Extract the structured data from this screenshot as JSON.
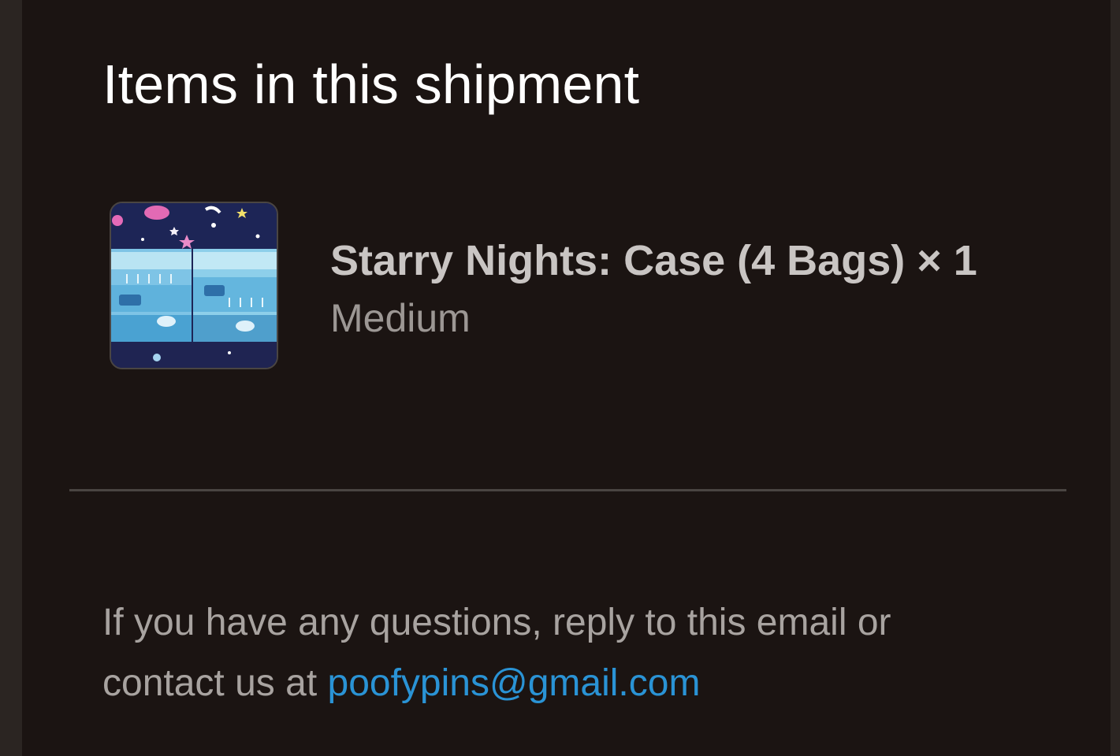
{
  "section": {
    "title": "Items in this shipment"
  },
  "item": {
    "name": "Starry Nights: Case (4 Bags) × 1",
    "variant": "Medium",
    "thumbnail_icon": "product-image"
  },
  "footer": {
    "text": "If you have any questions, reply to this email or contact us at ",
    "email": "poofypins@gmail.com",
    "email_href": "mailto:poofypins@gmail.com"
  },
  "colors": {
    "background": "#1b1412",
    "title": "#ffffff",
    "item_name": "#c9c5c3",
    "muted": "#9c9794",
    "link": "#2a93d5",
    "divider": "#4a4542"
  }
}
